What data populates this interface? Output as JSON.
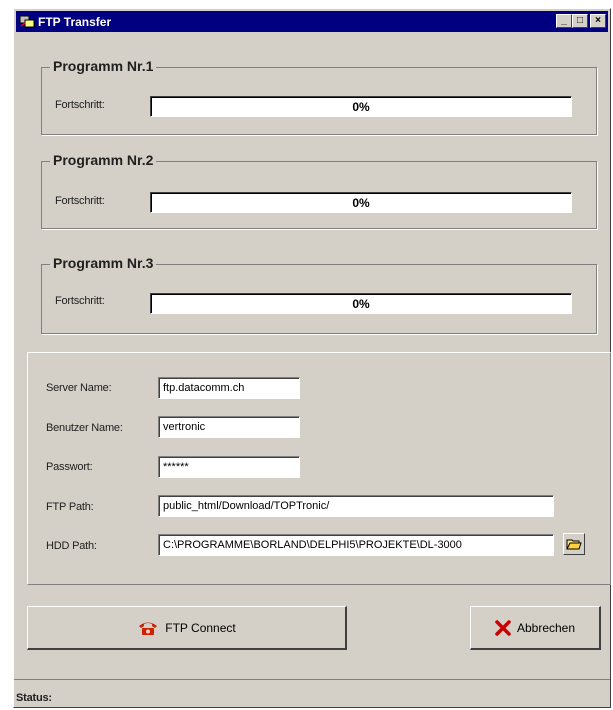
{
  "window": {
    "title": "FTP Transfer",
    "icon": "ftp-app-icon",
    "controls": {
      "minimize": "_",
      "maximize": "□",
      "close": "×"
    }
  },
  "programs": [
    {
      "title": "Programm Nr.1",
      "progress_label": "Fortschritt:",
      "progress_text": "0%",
      "progress": 0
    },
    {
      "title": "Programm Nr.2",
      "progress_label": "Fortschritt:",
      "progress_text": "0%",
      "progress": 0
    },
    {
      "title": "Programm Nr.3",
      "progress_label": "Fortschritt:",
      "progress_text": "0%",
      "progress": 0
    }
  ],
  "settings": {
    "server_name": {
      "label": "Server Name:",
      "value": "ftp.datacomm.ch"
    },
    "user_name": {
      "label": "Benutzer Name:",
      "value": "vertronic"
    },
    "password": {
      "label": "Passwort:",
      "value": "******"
    },
    "ftp_path": {
      "label": "FTP Path:",
      "value": "public_html/Download/TOPTronic/"
    },
    "hdd_path": {
      "label": "HDD Path:",
      "value": "C:\\PROGRAMME\\BORLAND\\DELPHI5\\PROJEKTE\\DL-3000"
    },
    "browse_icon": "folder-open-icon"
  },
  "buttons": {
    "connect_label": "FTP Connect",
    "connect_icon": "telephone-icon",
    "cancel_label": "Abbrechen",
    "cancel_icon": "red-x-icon"
  },
  "status": {
    "label": "Status:"
  },
  "colors": {
    "titlebar": "#000080",
    "face": "#d4d0c8",
    "cancel_x": "#cc0000",
    "phone": "#cc2200"
  }
}
